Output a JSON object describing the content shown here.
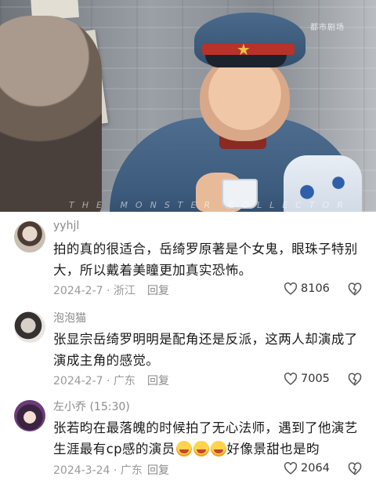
{
  "hero": {
    "watermark": "都市剧场",
    "caption": "THE MONSTER COLLECTOR"
  },
  "comments": [
    {
      "username": "yyhjl",
      "text": "拍的真的很适合，岳绮罗原著是个女鬼，眼珠子特别大，所以戴着美瞳更加真实恐怖。",
      "date": "2024-2-7",
      "location": "浙江",
      "reply_label": "回复",
      "likes": "8106"
    },
    {
      "username": "泡泡猫",
      "text": "张显宗岳绮罗明明是配角还是反派，这两人却演成了演成主角的感觉。",
      "date": "2024-2-7",
      "location": "广东",
      "reply_label": "回复",
      "likes": "7005"
    },
    {
      "username": "左小乔 (15:30)",
      "text_before": "张若昀在最落魄的时候拍了无心法师，遇到了他演艺生涯最有cp感的演员",
      "text_after": "好像景甜也是昀",
      "date": "2024-3-24",
      "location": "广东",
      "reply_label": "回复",
      "likes": "2064"
    }
  ],
  "colors": {
    "username": "#8a8a8a",
    "body_text": "#1a1a1a",
    "meta_text": "#9a9a9a"
  }
}
